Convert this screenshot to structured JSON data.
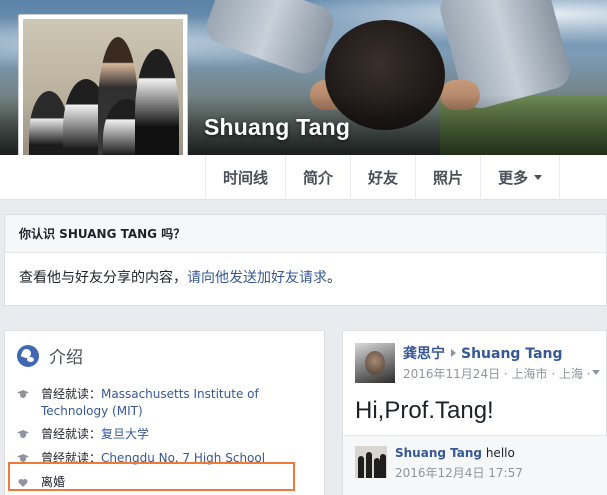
{
  "profile": {
    "name": "Shuang Tang"
  },
  "tabs": [
    {
      "label": "时间线"
    },
    {
      "label": "简介"
    },
    {
      "label": "好友"
    },
    {
      "label": "照片"
    },
    {
      "label": "更多"
    }
  ],
  "know_box": {
    "header": "你认识 SHUANG TANG 吗？",
    "body_prefix": "查看他与好友分享的内容，",
    "body_link": "请向他发送加好友请求",
    "body_suffix": "。"
  },
  "intro": {
    "title": "介绍",
    "items": [
      {
        "label": "曾经就读：",
        "value": "Massachusetts Institute of Technology (MIT)",
        "icon": "graduation-cap-icon"
      },
      {
        "label": "曾经就读：",
        "value": "复旦大学",
        "icon": "graduation-cap-icon"
      },
      {
        "label": "曾经就读：",
        "value": "Chengdu No. 7 High School",
        "icon": "graduation-cap-icon"
      },
      {
        "label": "离婚",
        "value": "",
        "icon": "heart-icon"
      }
    ]
  },
  "post": {
    "author": "龚思宁",
    "target": "Shuang Tang",
    "meta": "2016年11月24日 · 上海市 · 上海 · ",
    "text": "Hi,Prof.Tang!",
    "comment": {
      "author": "Shuang Tang",
      "text": " hello",
      "date": "2016年12月4日 17:57"
    }
  },
  "colors": {
    "link": "#365899",
    "highlight_box": "#ef7a3a",
    "background": "#e9ebee"
  }
}
